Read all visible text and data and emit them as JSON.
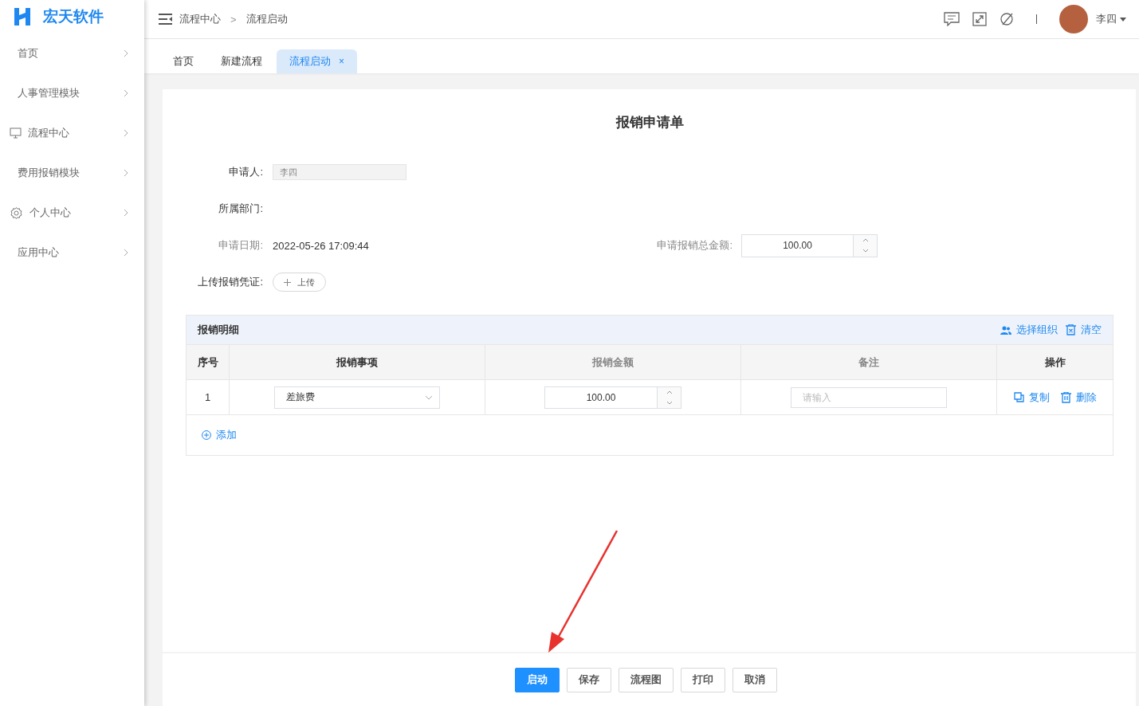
{
  "logo": {
    "text": "宏天软件"
  },
  "sidebar": {
    "items": [
      {
        "label": "首页",
        "kind": "plain"
      },
      {
        "label": "人事管理模块",
        "kind": "plain"
      },
      {
        "label": "流程中心",
        "kind": "monitor"
      },
      {
        "label": "费用报销模块",
        "kind": "plain"
      },
      {
        "label": "个人中心",
        "kind": "gear"
      },
      {
        "label": "应用中心",
        "kind": "plain"
      }
    ]
  },
  "breadcrumb": [
    "流程中心",
    "流程启动"
  ],
  "breadcrumb_separator": ">",
  "user": {
    "name": "李四"
  },
  "tabs": [
    {
      "label": "首页",
      "selected": false,
      "closable": false
    },
    {
      "label": "新建流程",
      "selected": false,
      "closable": false
    },
    {
      "label": "流程启动",
      "selected": true,
      "closable": true
    }
  ],
  "tab_close": "×",
  "form": {
    "title": "报销申请单",
    "applicant": {
      "label": "申请人:",
      "value": "李四",
      "dimmed": false
    },
    "department": {
      "label": "所属部门:",
      "dimmed": false
    },
    "date": {
      "label": "申请日期:",
      "value": "2022-05-26 17:09:44",
      "dimmed": true
    },
    "total": {
      "label": "申请报销总金额:",
      "value": "100.00",
      "dimmed": true
    },
    "upload": {
      "label": "上传报销凭证:",
      "button": "上传",
      "dimmed": false
    }
  },
  "details": {
    "title": "报销明细",
    "actions": [
      {
        "label": "选择组织",
        "kind": "users"
      },
      {
        "label": "清空",
        "kind": "trash-box"
      }
    ],
    "columns": [
      {
        "label": "序号",
        "dimmed": false
      },
      {
        "label": "报销事项",
        "dimmed": false
      },
      {
        "label": "报销金额",
        "dimmed": true
      },
      {
        "label": "备注",
        "dimmed": true
      },
      {
        "label": "操作",
        "dimmed": false
      }
    ],
    "rows": [
      {
        "index": "1",
        "item": "差旅费",
        "amount": "100.00",
        "note_placeholder": "请输入",
        "ops": [
          {
            "label": "复制",
            "kind": "copy"
          },
          {
            "label": "删除",
            "kind": "trash"
          }
        ]
      }
    ],
    "add": "添加"
  },
  "buttons": [
    {
      "label": "启动",
      "primary": true
    },
    {
      "label": "保存",
      "primary": false
    },
    {
      "label": "流程图",
      "primary": false
    },
    {
      "label": "打印",
      "primary": false
    },
    {
      "label": "取消",
      "primary": false
    }
  ]
}
